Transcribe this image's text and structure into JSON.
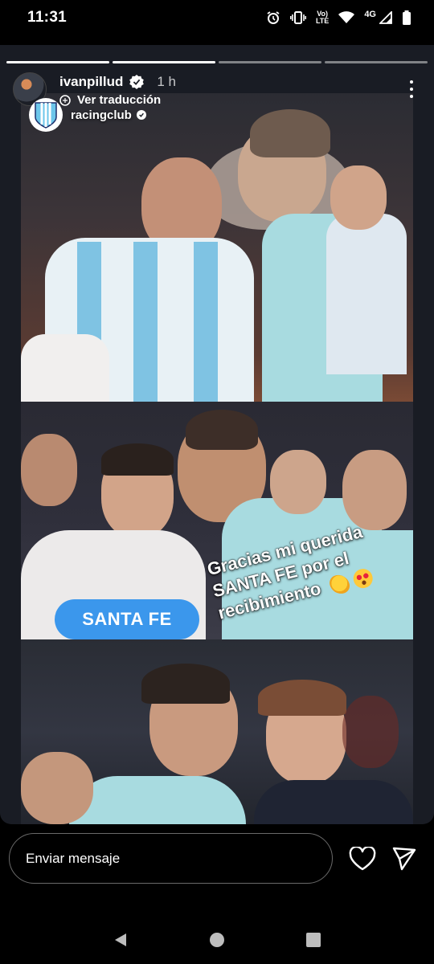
{
  "status_bar": {
    "time": "11:31",
    "network_top": "Vo)",
    "network_bottom": "LTE",
    "signal_label": "4G"
  },
  "story": {
    "progress_segments": 4,
    "progress_completed": 2,
    "username": "ivanpillud",
    "time_ago": "1 h",
    "translate_label": "Ver traducción",
    "reshared_from": "racingclub",
    "sticker_location": "SANTA FE",
    "caption": "Gracias mi querida SANTA FE por el recibimiento",
    "caption_emojis": [
      "clapping-hands-emoji",
      "heart-eyes-emoji"
    ]
  },
  "message_bar": {
    "placeholder": "Enviar mensaje"
  },
  "colors": {
    "background": "#000000",
    "story_bg": "#191c24",
    "sticker_blue": "#3b97ec",
    "racing_blue": "#6cc6ea"
  },
  "icons": [
    "alarm-icon",
    "vibrate-icon",
    "wifi-icon",
    "signal-icon",
    "battery-icon",
    "verified-icon",
    "translate-icon",
    "more-icon",
    "heart-icon",
    "send-icon",
    "back-icon",
    "home-icon",
    "recents-icon"
  ]
}
